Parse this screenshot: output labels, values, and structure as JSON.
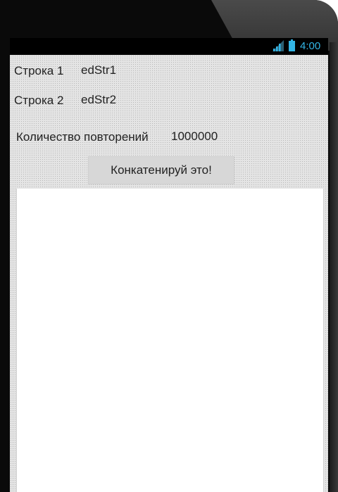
{
  "status_bar": {
    "time": "4:00",
    "icons": [
      "signal-icon",
      "battery-icon"
    ],
    "accent_color": "#33b5e5"
  },
  "form": {
    "row1_label": "Строка 1",
    "row1_value": "edStr1",
    "row2_label": "Строка 2",
    "row2_value": "edStr2",
    "repeat_label": "Количество повторений",
    "repeat_value": "1000000",
    "concat_button": "Конкатенируй это!",
    "result_text": ""
  }
}
